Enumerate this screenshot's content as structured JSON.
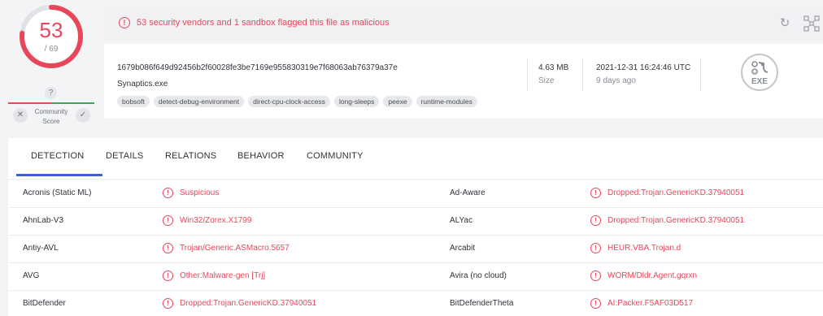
{
  "score": {
    "detections": "53",
    "total": "/ 69",
    "community_label": "Community Score",
    "question_mark": "?",
    "vote_down": "✕",
    "vote_up": "✓"
  },
  "alert": {
    "icon_glyph": "!",
    "text": "53 security vendors and 1 sandbox flagged this file as malicious",
    "icons": [
      "refresh-icon",
      "graph-icon"
    ]
  },
  "file": {
    "hash": "1679b086f649d92456b2f60028fe3be7169e955830319e7f68063ab76379a37e",
    "name": "Synaptics.exe",
    "size": "4.63 MB",
    "size_label": "Size",
    "date": "2021-12-31 16:24:46 UTC",
    "date_ago": "9 days ago",
    "type_label": "EXE",
    "tags": [
      "bobsoft",
      "detect-debug-environment",
      "direct-cpu-clock-access",
      "long-sleeps",
      "peexe",
      "runtime-modules"
    ]
  },
  "tabs": [
    "DETECTION",
    "DETAILS",
    "RELATIONS",
    "BEHAVIOR",
    "COMMUNITY"
  ],
  "active_tab": "DETECTION",
  "colors": {
    "malicious": "#e8475a",
    "accent": "#3d5fd8",
    "harmless": "#3fa55d"
  },
  "detections": [
    {
      "left_engine": "Acronis (Static ML)",
      "left_result": "Suspicious",
      "right_engine": "Ad-Aware",
      "right_result": "Dropped:Trojan.GenericKD.37940051"
    },
    {
      "left_engine": "AhnLab-V3",
      "left_result": "Win32/Zorex.X1799",
      "right_engine": "ALYac",
      "right_result": "Dropped:Trojan.GenericKD.37940051"
    },
    {
      "left_engine": "Antiy-AVL",
      "left_result": "Trojan/Generic.ASMacro.5657",
      "right_engine": "Arcabit",
      "right_result": "HEUR.VBA.Trojan.d"
    },
    {
      "left_engine": "AVG",
      "left_result": "Other:Malware-gen [Trj]",
      "right_engine": "Avira (no cloud)",
      "right_result": "WORM/Dldr.Agent.gqrxn"
    },
    {
      "left_engine": "BitDefender",
      "left_result": "Dropped:Trojan.GenericKD.37940051",
      "right_engine": "BitDefenderTheta",
      "right_result": "AI:Packer.F5AF03D517"
    }
  ]
}
